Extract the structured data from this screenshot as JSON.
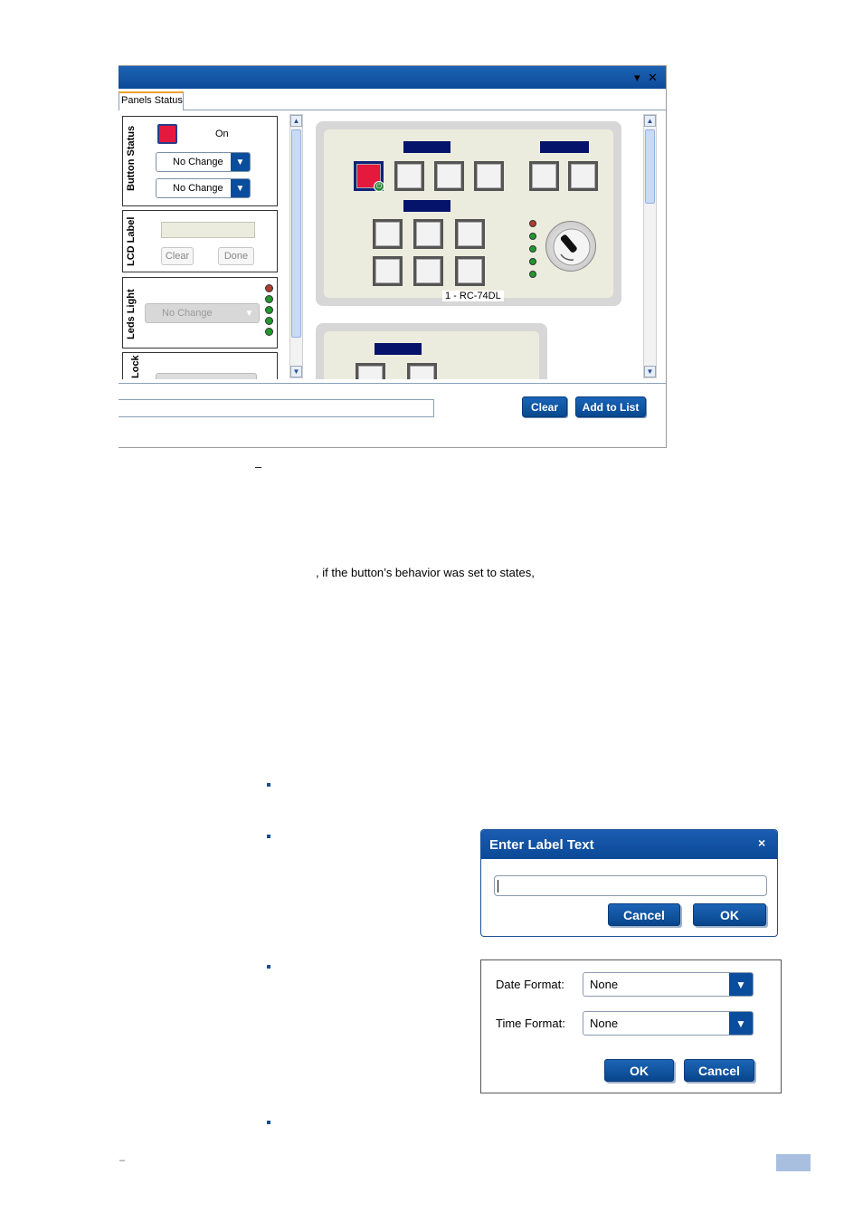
{
  "window": {
    "title_controls": {
      "pin": "▾",
      "close": "✕"
    },
    "tab_label": "Panels Status",
    "button_status": {
      "group_label": "Button Status",
      "state_text": "On",
      "dropdown1": "No Change",
      "dropdown2": "No Change"
    },
    "lcd_label": {
      "group_label": "LCD Label",
      "clear": "Clear",
      "done": "Done"
    },
    "leds_light": {
      "group_label": "Leds Light",
      "dropdown": "No Change"
    },
    "lock": {
      "group_label": "Lock"
    },
    "panel": {
      "name": "1 - RC-74DL"
    },
    "bottom": {
      "clear": "Clear",
      "add_to_list": "Add to List"
    }
  },
  "doc": {
    "dash": "–",
    "fragment": ", if the button’s behavior was set to states,",
    "footer_dash": "–"
  },
  "dialog_label": {
    "title": "Enter Label Text",
    "close": "×",
    "cancel": "Cancel",
    "ok": "OK"
  },
  "dialog_datetime": {
    "date_label": "Date Format:",
    "date_value": "None",
    "time_label": "Time Format:",
    "time_value": "None",
    "ok": "OK",
    "cancel": "Cancel"
  }
}
